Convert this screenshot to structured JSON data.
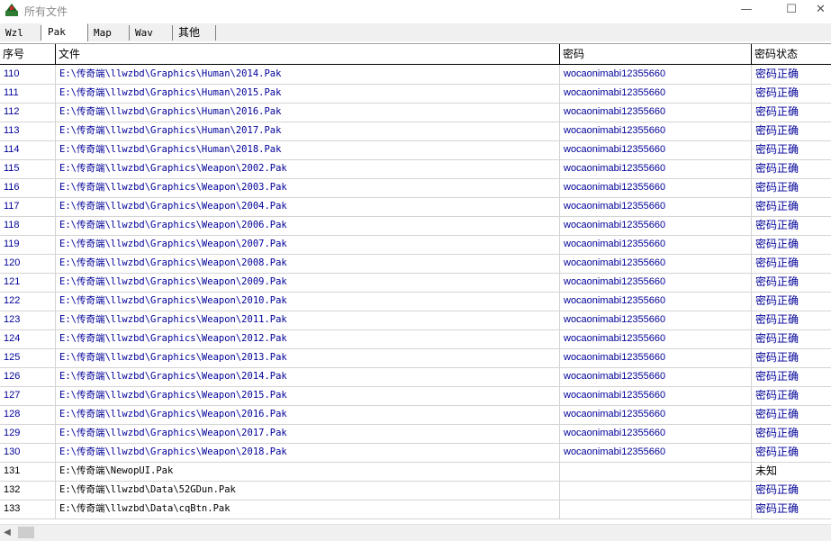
{
  "window": {
    "title": "所有文件"
  },
  "tabs": [
    "Wzl",
    "Pak",
    "Map",
    "Wav",
    "其他"
  ],
  "columns": [
    "序号",
    "文件",
    "密码",
    "密码状态"
  ],
  "rows": [
    {
      "idx": "110",
      "file": "E:\\传奇端\\llwzbd\\Graphics\\Human\\2014.Pak",
      "pwd": "wocaonimabi12355660",
      "status": "密码正确"
    },
    {
      "idx": "111",
      "file": "E:\\传奇端\\llwzbd\\Graphics\\Human\\2015.Pak",
      "pwd": "wocaonimabi12355660",
      "status": "密码正确"
    },
    {
      "idx": "112",
      "file": "E:\\传奇端\\llwzbd\\Graphics\\Human\\2016.Pak",
      "pwd": "wocaonimabi12355660",
      "status": "密码正确"
    },
    {
      "idx": "113",
      "file": "E:\\传奇端\\llwzbd\\Graphics\\Human\\2017.Pak",
      "pwd": "wocaonimabi12355660",
      "status": "密码正确"
    },
    {
      "idx": "114",
      "file": "E:\\传奇端\\llwzbd\\Graphics\\Human\\2018.Pak",
      "pwd": "wocaonimabi12355660",
      "status": "密码正确"
    },
    {
      "idx": "115",
      "file": "E:\\传奇端\\llwzbd\\Graphics\\Weapon\\2002.Pak",
      "pwd": "wocaonimabi12355660",
      "status": "密码正确"
    },
    {
      "idx": "116",
      "file": "E:\\传奇端\\llwzbd\\Graphics\\Weapon\\2003.Pak",
      "pwd": "wocaonimabi12355660",
      "status": "密码正确"
    },
    {
      "idx": "117",
      "file": "E:\\传奇端\\llwzbd\\Graphics\\Weapon\\2004.Pak",
      "pwd": "wocaonimabi12355660",
      "status": "密码正确"
    },
    {
      "idx": "118",
      "file": "E:\\传奇端\\llwzbd\\Graphics\\Weapon\\2006.Pak",
      "pwd": "wocaonimabi12355660",
      "status": "密码正确"
    },
    {
      "idx": "119",
      "file": "E:\\传奇端\\llwzbd\\Graphics\\Weapon\\2007.Pak",
      "pwd": "wocaonimabi12355660",
      "status": "密码正确"
    },
    {
      "idx": "120",
      "file": "E:\\传奇端\\llwzbd\\Graphics\\Weapon\\2008.Pak",
      "pwd": "wocaonimabi12355660",
      "status": "密码正确"
    },
    {
      "idx": "121",
      "file": "E:\\传奇端\\llwzbd\\Graphics\\Weapon\\2009.Pak",
      "pwd": "wocaonimabi12355660",
      "status": "密码正确"
    },
    {
      "idx": "122",
      "file": "E:\\传奇端\\llwzbd\\Graphics\\Weapon\\2010.Pak",
      "pwd": "wocaonimabi12355660",
      "status": "密码正确"
    },
    {
      "idx": "123",
      "file": "E:\\传奇端\\llwzbd\\Graphics\\Weapon\\2011.Pak",
      "pwd": "wocaonimabi12355660",
      "status": "密码正确"
    },
    {
      "idx": "124",
      "file": "E:\\传奇端\\llwzbd\\Graphics\\Weapon\\2012.Pak",
      "pwd": "wocaonimabi12355660",
      "status": "密码正确"
    },
    {
      "idx": "125",
      "file": "E:\\传奇端\\llwzbd\\Graphics\\Weapon\\2013.Pak",
      "pwd": "wocaonimabi12355660",
      "status": "密码正确"
    },
    {
      "idx": "126",
      "file": "E:\\传奇端\\llwzbd\\Graphics\\Weapon\\2014.Pak",
      "pwd": "wocaonimabi12355660",
      "status": "密码正确"
    },
    {
      "idx": "127",
      "file": "E:\\传奇端\\llwzbd\\Graphics\\Weapon\\2015.Pak",
      "pwd": "wocaonimabi12355660",
      "status": "密码正确"
    },
    {
      "idx": "128",
      "file": "E:\\传奇端\\llwzbd\\Graphics\\Weapon\\2016.Pak",
      "pwd": "wocaonimabi12355660",
      "status": "密码正确"
    },
    {
      "idx": "129",
      "file": "E:\\传奇端\\llwzbd\\Graphics\\Weapon\\2017.Pak",
      "pwd": "wocaonimabi12355660",
      "status": "密码正确"
    },
    {
      "idx": "130",
      "file": "E:\\传奇端\\llwzbd\\Graphics\\Weapon\\2018.Pak",
      "pwd": "wocaonimabi12355660",
      "status": "密码正确"
    },
    {
      "idx": "131",
      "file": "E:\\传奇端\\NewopUI.Pak",
      "pwd": "",
      "status": "未知"
    },
    {
      "idx": "132",
      "file": "E:\\传奇端\\llwzbd\\Data\\52GDun.Pak",
      "pwd": "",
      "status": "密码正确"
    },
    {
      "idx": "133",
      "file": "E:\\传奇端\\llwzbd\\Data\\cqBtn.Pak",
      "pwd": "",
      "status": "密码正确"
    }
  ],
  "colors": {
    "row_text": "#000099",
    "plain_text": "#000000",
    "grid": "#d4d4d4"
  },
  "icons": {
    "app": "folder-tree-icon",
    "close": "close-icon",
    "maximize": "maximize-icon",
    "minimize": "minimize-icon",
    "scroll_left": "scroll-left-arrow-icon"
  }
}
